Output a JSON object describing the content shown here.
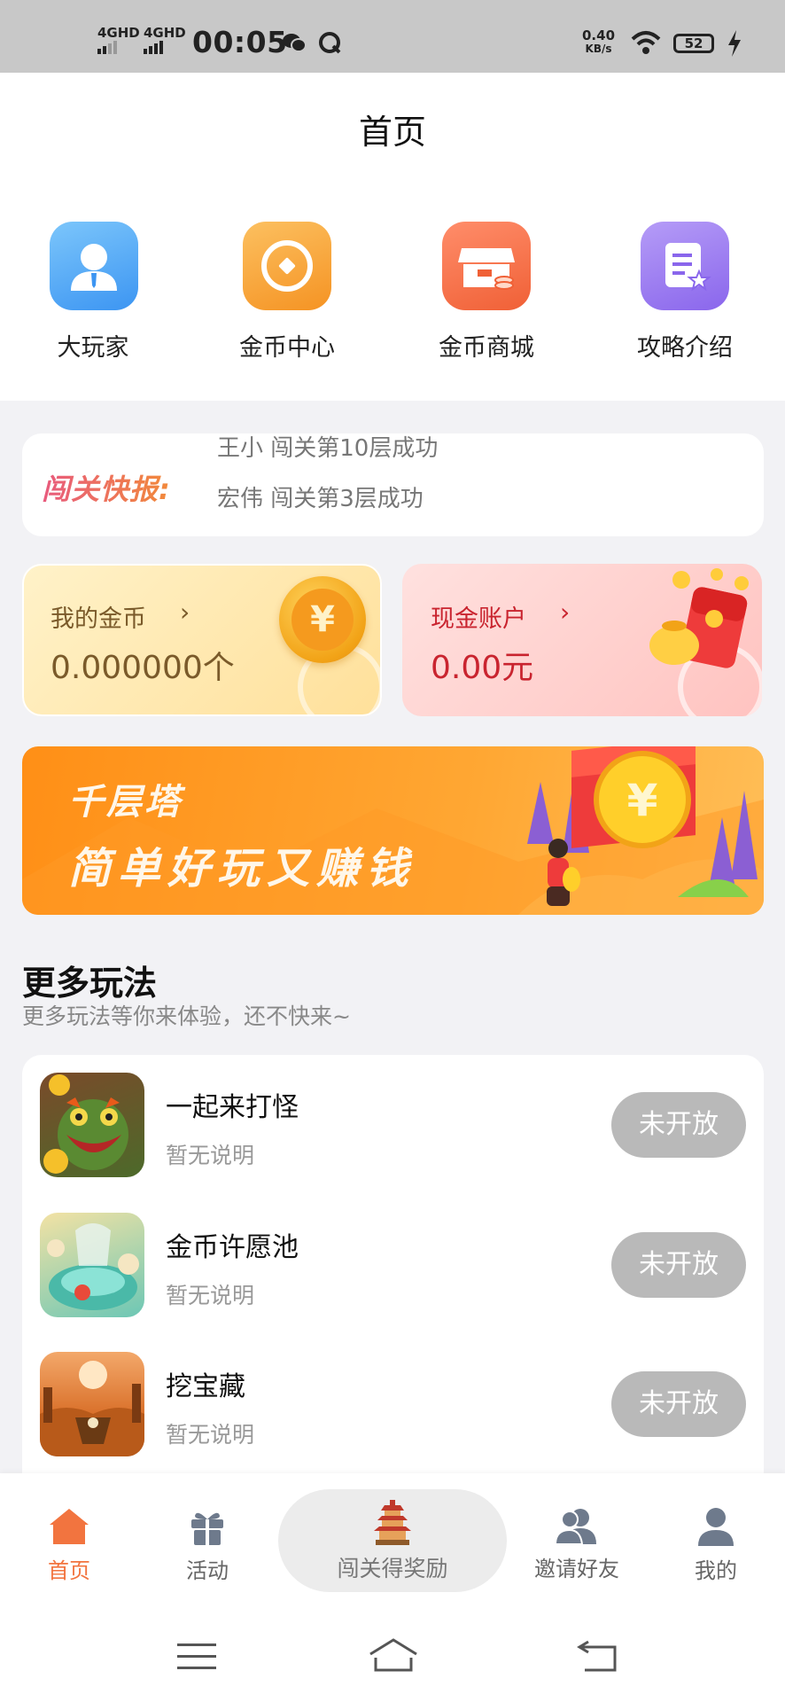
{
  "status_bar": {
    "net1": "4GHD",
    "net2": "4GHD",
    "time": "00:05",
    "speed_value": "0.40",
    "speed_unit": "KB/s",
    "battery": "52"
  },
  "header": {
    "title": "首页"
  },
  "quick_links": [
    {
      "label": "大玩家",
      "icon": "player-icon",
      "color": "#4ea6f6"
    },
    {
      "label": "金币中心",
      "icon": "coin-icon",
      "color": "#f7a33b"
    },
    {
      "label": "金币商城",
      "icon": "store-icon",
      "color": "#f4704a"
    },
    {
      "label": "攻略介绍",
      "icon": "guide-icon",
      "color": "#9c7cf0"
    }
  ],
  "ticker": {
    "title": "闯关快报:",
    "lines": [
      "王小 闯关第10层成功",
      "宏伟 闯关第3层成功"
    ]
  },
  "wallet": {
    "coins_label": "我的金币",
    "coins_value": "0.000000个",
    "cash_label": "现金账户",
    "cash_value": "0.00元"
  },
  "banner": {
    "line1": "千层塔",
    "line2": "简单好玩又赚钱"
  },
  "more": {
    "title": "更多玩法",
    "subtitle": "更多玩法等你来体验，还不快来~",
    "games": [
      {
        "name": "一起来打怪",
        "desc": "暂无说明",
        "button": "未开放"
      },
      {
        "name": "金币许愿池",
        "desc": "暂无说明",
        "button": "未开放"
      },
      {
        "name": "挖宝藏",
        "desc": "暂无说明",
        "button": "未开放"
      }
    ]
  },
  "nav": {
    "items": [
      {
        "label": "首页",
        "icon": "home-icon"
      },
      {
        "label": "活动",
        "icon": "gift-icon"
      },
      {
        "label": "闯关得奖励",
        "icon": "pagoda-icon"
      },
      {
        "label": "邀请好友",
        "icon": "friends-icon"
      },
      {
        "label": "我的",
        "icon": "user-icon"
      }
    ],
    "active_color": "#f2743f"
  }
}
